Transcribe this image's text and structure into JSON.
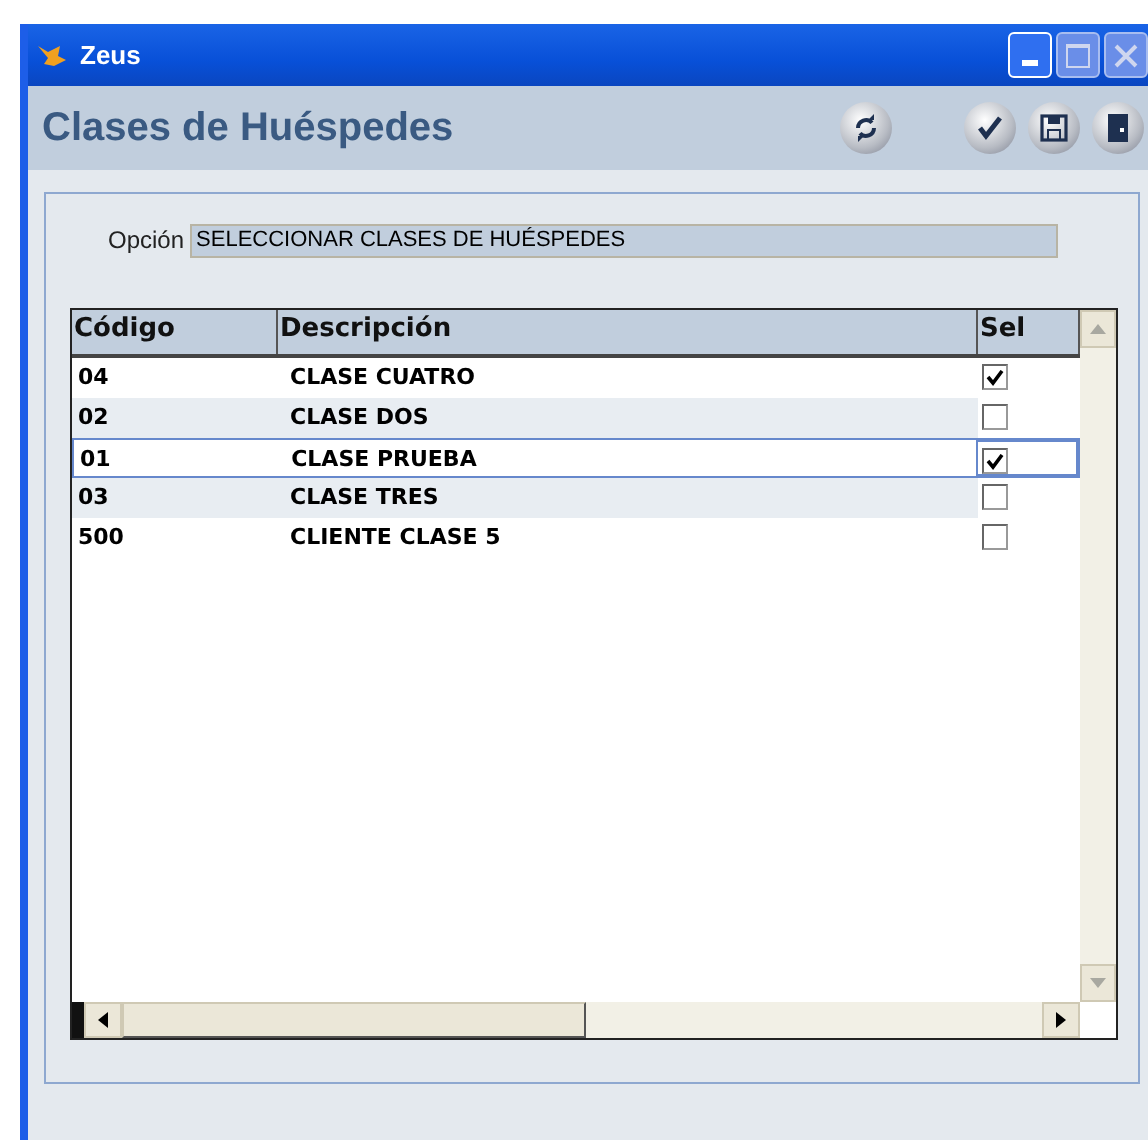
{
  "window": {
    "title": "Zeus"
  },
  "header": {
    "title": "Clases de Huéspedes"
  },
  "option": {
    "label": "Opción",
    "value": "SELECCIONAR CLASES DE HUÉSPEDES"
  },
  "table": {
    "columns": [
      "Código",
      "Descripción",
      "Sel"
    ],
    "rows": [
      {
        "code": "04",
        "description": "CLASE CUATRO",
        "checked": true,
        "selected": false
      },
      {
        "code": "02",
        "description": "CLASE DOS",
        "checked": false,
        "selected": false
      },
      {
        "code": "01",
        "description": "CLASE PRUEBA",
        "checked": true,
        "selected": true
      },
      {
        "code": "03",
        "description": "CLASE TRES",
        "checked": false,
        "selected": false
      },
      {
        "code": "500",
        "description": "CLIENTE CLASE 5",
        "checked": false,
        "selected": false
      }
    ]
  }
}
